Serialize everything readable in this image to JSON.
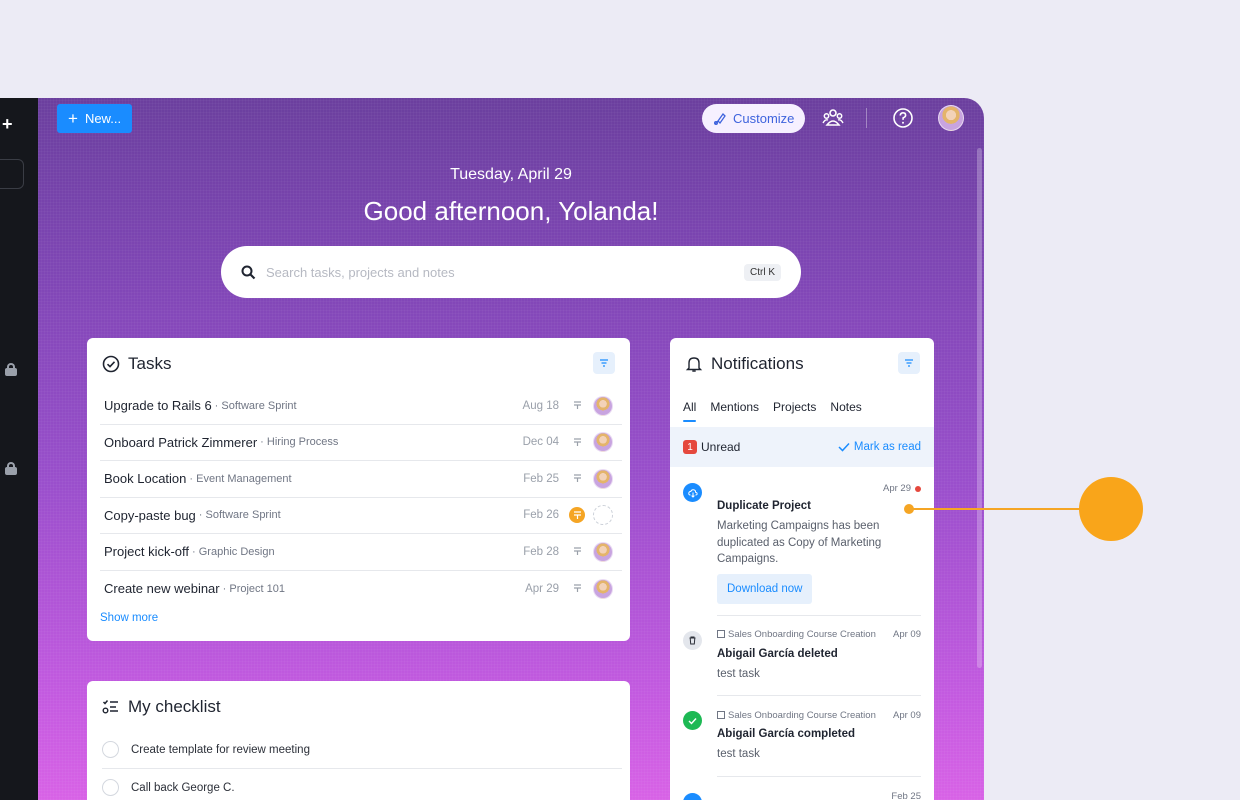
{
  "header": {
    "new_label": "New...",
    "customize_label": "Customize"
  },
  "hero": {
    "date": "Tuesday, April 29",
    "greeting": "Good afternoon, Yolanda!"
  },
  "search": {
    "placeholder": "Search tasks, projects and notes",
    "shortcut": "Ctrl K"
  },
  "tasks": {
    "title": "Tasks",
    "show_more": "Show more",
    "items": [
      {
        "name": "Upgrade to Rails 6",
        "project": "Software Sprint",
        "date": "Aug 18",
        "priority": "inactive",
        "assignee": "avatar"
      },
      {
        "name": "Onboard Patrick Zimmerer",
        "project": "Hiring Process",
        "date": "Dec 04",
        "priority": "inactive",
        "assignee": "avatar"
      },
      {
        "name": "Book Location",
        "project": "Event Management",
        "date": "Feb 25",
        "priority": "inactive",
        "assignee": "avatar"
      },
      {
        "name": "Copy-paste bug",
        "project": "Software Sprint",
        "date": "Feb 26",
        "priority": "active",
        "assignee": "empty"
      },
      {
        "name": "Project kick-off",
        "project": "Graphic Design",
        "date": "Feb 28",
        "priority": "inactive",
        "assignee": "avatar"
      },
      {
        "name": "Create new webinar",
        "project": "Project 101",
        "date": "Apr 29",
        "priority": "inactive",
        "assignee": "avatar"
      }
    ]
  },
  "checklist": {
    "title": "My checklist",
    "items": [
      {
        "text": "Create template for review meeting"
      },
      {
        "text": "Call back George C."
      }
    ]
  },
  "notifications": {
    "title": "Notifications",
    "tabs": [
      "All",
      "Mentions",
      "Projects",
      "Notes"
    ],
    "unread_count": "1",
    "unread_label": "Unread",
    "mark_read_label": "Mark as read",
    "items": [
      {
        "date": "Apr 29",
        "title": "Duplicate Project",
        "body": "Marketing Campaigns has been duplicated as Copy of Marketing Campaigns.",
        "action": "Download now",
        "icon": "cloud-download-icon",
        "icon_color": "#1a8cff"
      },
      {
        "meta": "Sales Onboarding Course Creation",
        "date": "Apr 09",
        "title": "Abigail García deleted",
        "body": "test task",
        "icon": "trash-icon",
        "icon_color": "#e3e6ec"
      },
      {
        "meta": "Sales Onboarding Course Creation",
        "date": "Apr 09",
        "title": "Abigail García completed",
        "body": "test task",
        "icon": "check-icon",
        "icon_color": "#1db954"
      },
      {
        "date": "Feb 25",
        "icon": "notification-icon",
        "icon_color": "#1a8cff"
      }
    ]
  },
  "colors": {
    "accent": "#1a8cff",
    "highlight": "#f9a51a",
    "sidebar": "#15171c"
  }
}
